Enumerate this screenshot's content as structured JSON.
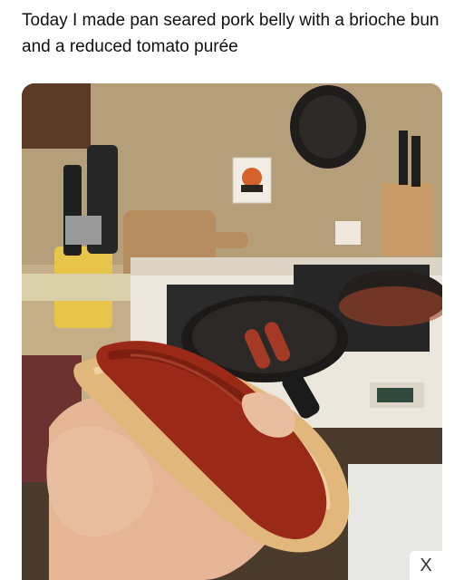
{
  "post": {
    "caption": "Today I made pan seared pork belly with a brioche bun and a reduced tomato purée"
  },
  "photo": {
    "alt": "pan seared pork belly with a brioche bun and a reduced tomato purée"
  },
  "overlay": {
    "close_label": "X",
    "close_icon": "close-icon"
  },
  "colors": {
    "wall": "#cbb58f",
    "stove": "#e9e3d6",
    "bun": "#e8c48f",
    "sausage": "#9c2a18",
    "ketchup": "#8a1f10"
  }
}
